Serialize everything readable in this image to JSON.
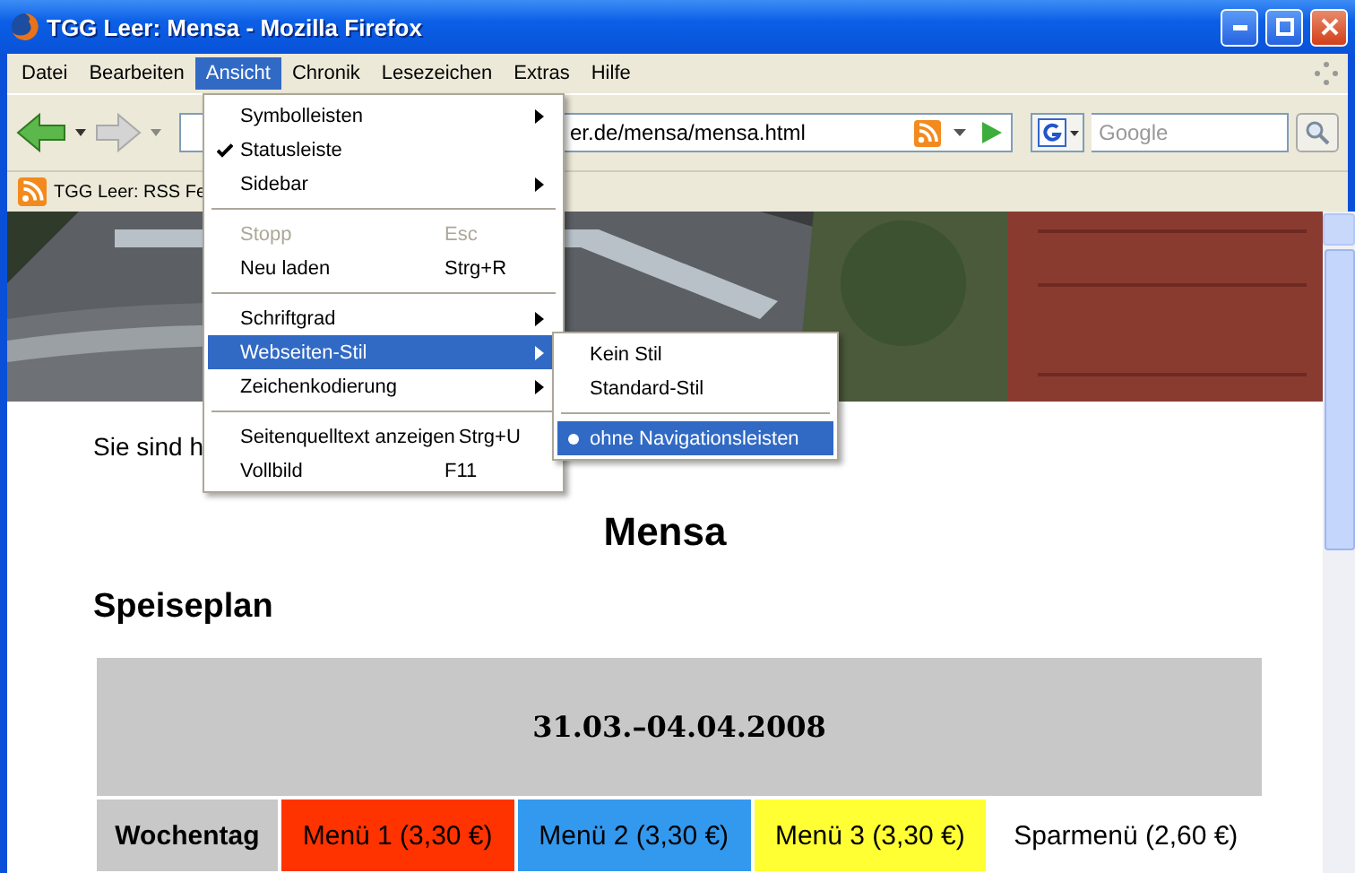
{
  "window": {
    "title": "TGG Leer: Mensa - Mozilla Firefox"
  },
  "menubar": [
    {
      "label": "Datei",
      "selected": false
    },
    {
      "label": "Bearbeiten",
      "selected": false
    },
    {
      "label": "Ansicht",
      "selected": true
    },
    {
      "label": "Chronik",
      "selected": false
    },
    {
      "label": "Lesezeichen",
      "selected": false
    },
    {
      "label": "Extras",
      "selected": false
    },
    {
      "label": "Hilfe",
      "selected": false
    }
  ],
  "toolbar": {
    "url": "er.de/mensa/mensa.html",
    "search": {
      "placeholder": "Google"
    }
  },
  "bookmarks": [
    {
      "label": "TGG Leer: RSS Fe"
    }
  ],
  "menu": [
    {
      "kind": "item",
      "label": "Symbolleisten",
      "submenu": true,
      "checked": false,
      "disabled": false,
      "selected": false
    },
    {
      "kind": "item",
      "label": "Statusleiste",
      "submenu": false,
      "checked": true,
      "disabled": false,
      "selected": false
    },
    {
      "kind": "item",
      "label": "Sidebar",
      "submenu": true,
      "checked": false,
      "disabled": false,
      "selected": false
    },
    {
      "kind": "separator"
    },
    {
      "kind": "item",
      "label": "Stopp",
      "shortcut": "Esc",
      "submenu": false,
      "checked": false,
      "disabled": true,
      "selected": false
    },
    {
      "kind": "item",
      "label": "Neu laden",
      "shortcut": "Strg+R",
      "submenu": false,
      "checked": false,
      "disabled": false,
      "selected": false
    },
    {
      "kind": "separator"
    },
    {
      "kind": "item",
      "label": "Schriftgrad",
      "submenu": true,
      "checked": false,
      "disabled": false,
      "selected": false
    },
    {
      "kind": "item",
      "label": "Webseiten-Stil",
      "submenu": true,
      "checked": false,
      "disabled": false,
      "selected": true
    },
    {
      "kind": "item",
      "label": "Zeichenkodierung",
      "submenu": true,
      "checked": false,
      "disabled": false,
      "selected": false
    },
    {
      "kind": "separator"
    },
    {
      "kind": "item",
      "label": "Seitenquelltext anzeigen",
      "shortcut": "Strg+U",
      "submenu": false,
      "checked": false,
      "disabled": false,
      "selected": false
    },
    {
      "kind": "item",
      "label": "Vollbild",
      "shortcut": "F11",
      "submenu": false,
      "checked": false,
      "disabled": false,
      "selected": false
    }
  ],
  "submenu": [
    {
      "kind": "item",
      "label": "Kein Stil",
      "checked": false,
      "selected": false
    },
    {
      "kind": "item",
      "label": "Standard-Stil",
      "checked": false,
      "selected": false
    },
    {
      "kind": "separator"
    },
    {
      "kind": "item",
      "label": "ohne Navigationsleisten",
      "checked": true,
      "selected": true
    }
  ],
  "page": {
    "breadcrumb": "Sie sind h",
    "heading": "Mensa",
    "subheading": "Speiseplan",
    "table": {
      "title": "31.03.–04.04.2008",
      "columns": [
        {
          "label": "Wochentag",
          "color": "#c8c8c8"
        },
        {
          "label": "Menü 1 (3,30 €)",
          "color": "#ff3300"
        },
        {
          "label": "Menü 2 (3,30 €)",
          "color": "#3399ee"
        },
        {
          "label": "Menü 3 (3,30 €)",
          "color": "#ffff33"
        },
        {
          "label": "Sparmenü (2,60 €)",
          "color": "#ffffff"
        }
      ]
    }
  }
}
